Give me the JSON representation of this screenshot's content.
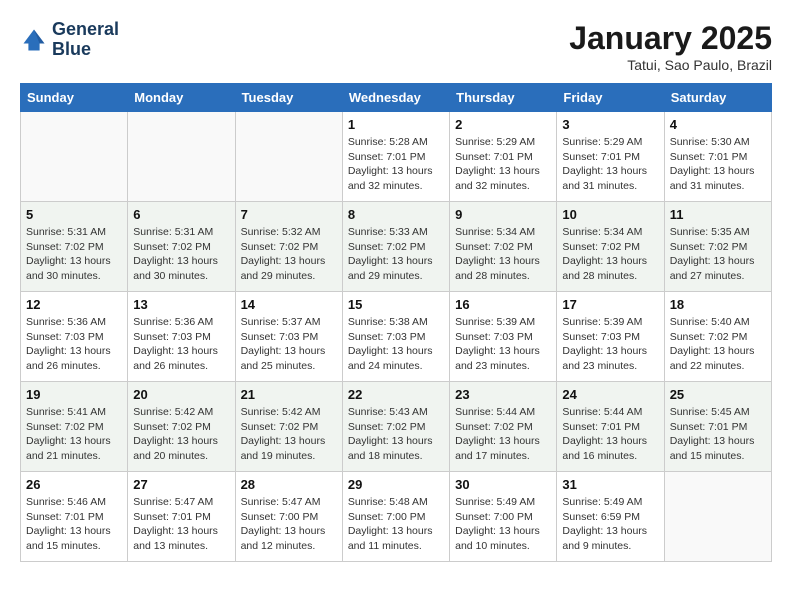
{
  "header": {
    "logo_line1": "General",
    "logo_line2": "Blue",
    "month": "January 2025",
    "location": "Tatui, Sao Paulo, Brazil"
  },
  "weekdays": [
    "Sunday",
    "Monday",
    "Tuesday",
    "Wednesday",
    "Thursday",
    "Friday",
    "Saturday"
  ],
  "weeks": [
    [
      {
        "day": "",
        "sunrise": "",
        "sunset": "",
        "daylight": "",
        "empty": true
      },
      {
        "day": "",
        "sunrise": "",
        "sunset": "",
        "daylight": "",
        "empty": true
      },
      {
        "day": "",
        "sunrise": "",
        "sunset": "",
        "daylight": "",
        "empty": true
      },
      {
        "day": "1",
        "sunrise": "Sunrise: 5:28 AM",
        "sunset": "Sunset: 7:01 PM",
        "daylight": "Daylight: 13 hours and 32 minutes.",
        "empty": false
      },
      {
        "day": "2",
        "sunrise": "Sunrise: 5:29 AM",
        "sunset": "Sunset: 7:01 PM",
        "daylight": "Daylight: 13 hours and 32 minutes.",
        "empty": false
      },
      {
        "day": "3",
        "sunrise": "Sunrise: 5:29 AM",
        "sunset": "Sunset: 7:01 PM",
        "daylight": "Daylight: 13 hours and 31 minutes.",
        "empty": false
      },
      {
        "day": "4",
        "sunrise": "Sunrise: 5:30 AM",
        "sunset": "Sunset: 7:01 PM",
        "daylight": "Daylight: 13 hours and 31 minutes.",
        "empty": false
      }
    ],
    [
      {
        "day": "5",
        "sunrise": "Sunrise: 5:31 AM",
        "sunset": "Sunset: 7:02 PM",
        "daylight": "Daylight: 13 hours and 30 minutes.",
        "empty": false
      },
      {
        "day": "6",
        "sunrise": "Sunrise: 5:31 AM",
        "sunset": "Sunset: 7:02 PM",
        "daylight": "Daylight: 13 hours and 30 minutes.",
        "empty": false
      },
      {
        "day": "7",
        "sunrise": "Sunrise: 5:32 AM",
        "sunset": "Sunset: 7:02 PM",
        "daylight": "Daylight: 13 hours and 29 minutes.",
        "empty": false
      },
      {
        "day": "8",
        "sunrise": "Sunrise: 5:33 AM",
        "sunset": "Sunset: 7:02 PM",
        "daylight": "Daylight: 13 hours and 29 minutes.",
        "empty": false
      },
      {
        "day": "9",
        "sunrise": "Sunrise: 5:34 AM",
        "sunset": "Sunset: 7:02 PM",
        "daylight": "Daylight: 13 hours and 28 minutes.",
        "empty": false
      },
      {
        "day": "10",
        "sunrise": "Sunrise: 5:34 AM",
        "sunset": "Sunset: 7:02 PM",
        "daylight": "Daylight: 13 hours and 28 minutes.",
        "empty": false
      },
      {
        "day": "11",
        "sunrise": "Sunrise: 5:35 AM",
        "sunset": "Sunset: 7:02 PM",
        "daylight": "Daylight: 13 hours and 27 minutes.",
        "empty": false
      }
    ],
    [
      {
        "day": "12",
        "sunrise": "Sunrise: 5:36 AM",
        "sunset": "Sunset: 7:03 PM",
        "daylight": "Daylight: 13 hours and 26 minutes.",
        "empty": false
      },
      {
        "day": "13",
        "sunrise": "Sunrise: 5:36 AM",
        "sunset": "Sunset: 7:03 PM",
        "daylight": "Daylight: 13 hours and 26 minutes.",
        "empty": false
      },
      {
        "day": "14",
        "sunrise": "Sunrise: 5:37 AM",
        "sunset": "Sunset: 7:03 PM",
        "daylight": "Daylight: 13 hours and 25 minutes.",
        "empty": false
      },
      {
        "day": "15",
        "sunrise": "Sunrise: 5:38 AM",
        "sunset": "Sunset: 7:03 PM",
        "daylight": "Daylight: 13 hours and 24 minutes.",
        "empty": false
      },
      {
        "day": "16",
        "sunrise": "Sunrise: 5:39 AM",
        "sunset": "Sunset: 7:03 PM",
        "daylight": "Daylight: 13 hours and 23 minutes.",
        "empty": false
      },
      {
        "day": "17",
        "sunrise": "Sunrise: 5:39 AM",
        "sunset": "Sunset: 7:03 PM",
        "daylight": "Daylight: 13 hours and 23 minutes.",
        "empty": false
      },
      {
        "day": "18",
        "sunrise": "Sunrise: 5:40 AM",
        "sunset": "Sunset: 7:02 PM",
        "daylight": "Daylight: 13 hours and 22 minutes.",
        "empty": false
      }
    ],
    [
      {
        "day": "19",
        "sunrise": "Sunrise: 5:41 AM",
        "sunset": "Sunset: 7:02 PM",
        "daylight": "Daylight: 13 hours and 21 minutes.",
        "empty": false
      },
      {
        "day": "20",
        "sunrise": "Sunrise: 5:42 AM",
        "sunset": "Sunset: 7:02 PM",
        "daylight": "Daylight: 13 hours and 20 minutes.",
        "empty": false
      },
      {
        "day": "21",
        "sunrise": "Sunrise: 5:42 AM",
        "sunset": "Sunset: 7:02 PM",
        "daylight": "Daylight: 13 hours and 19 minutes.",
        "empty": false
      },
      {
        "day": "22",
        "sunrise": "Sunrise: 5:43 AM",
        "sunset": "Sunset: 7:02 PM",
        "daylight": "Daylight: 13 hours and 18 minutes.",
        "empty": false
      },
      {
        "day": "23",
        "sunrise": "Sunrise: 5:44 AM",
        "sunset": "Sunset: 7:02 PM",
        "daylight": "Daylight: 13 hours and 17 minutes.",
        "empty": false
      },
      {
        "day": "24",
        "sunrise": "Sunrise: 5:44 AM",
        "sunset": "Sunset: 7:01 PM",
        "daylight": "Daylight: 13 hours and 16 minutes.",
        "empty": false
      },
      {
        "day": "25",
        "sunrise": "Sunrise: 5:45 AM",
        "sunset": "Sunset: 7:01 PM",
        "daylight": "Daylight: 13 hours and 15 minutes.",
        "empty": false
      }
    ],
    [
      {
        "day": "26",
        "sunrise": "Sunrise: 5:46 AM",
        "sunset": "Sunset: 7:01 PM",
        "daylight": "Daylight: 13 hours and 15 minutes.",
        "empty": false
      },
      {
        "day": "27",
        "sunrise": "Sunrise: 5:47 AM",
        "sunset": "Sunset: 7:01 PM",
        "daylight": "Daylight: 13 hours and 13 minutes.",
        "empty": false
      },
      {
        "day": "28",
        "sunrise": "Sunrise: 5:47 AM",
        "sunset": "Sunset: 7:00 PM",
        "daylight": "Daylight: 13 hours and 12 minutes.",
        "empty": false
      },
      {
        "day": "29",
        "sunrise": "Sunrise: 5:48 AM",
        "sunset": "Sunset: 7:00 PM",
        "daylight": "Daylight: 13 hours and 11 minutes.",
        "empty": false
      },
      {
        "day": "30",
        "sunrise": "Sunrise: 5:49 AM",
        "sunset": "Sunset: 7:00 PM",
        "daylight": "Daylight: 13 hours and 10 minutes.",
        "empty": false
      },
      {
        "day": "31",
        "sunrise": "Sunrise: 5:49 AM",
        "sunset": "Sunset: 6:59 PM",
        "daylight": "Daylight: 13 hours and 9 minutes.",
        "empty": false
      },
      {
        "day": "",
        "sunrise": "",
        "sunset": "",
        "daylight": "",
        "empty": true
      }
    ]
  ]
}
